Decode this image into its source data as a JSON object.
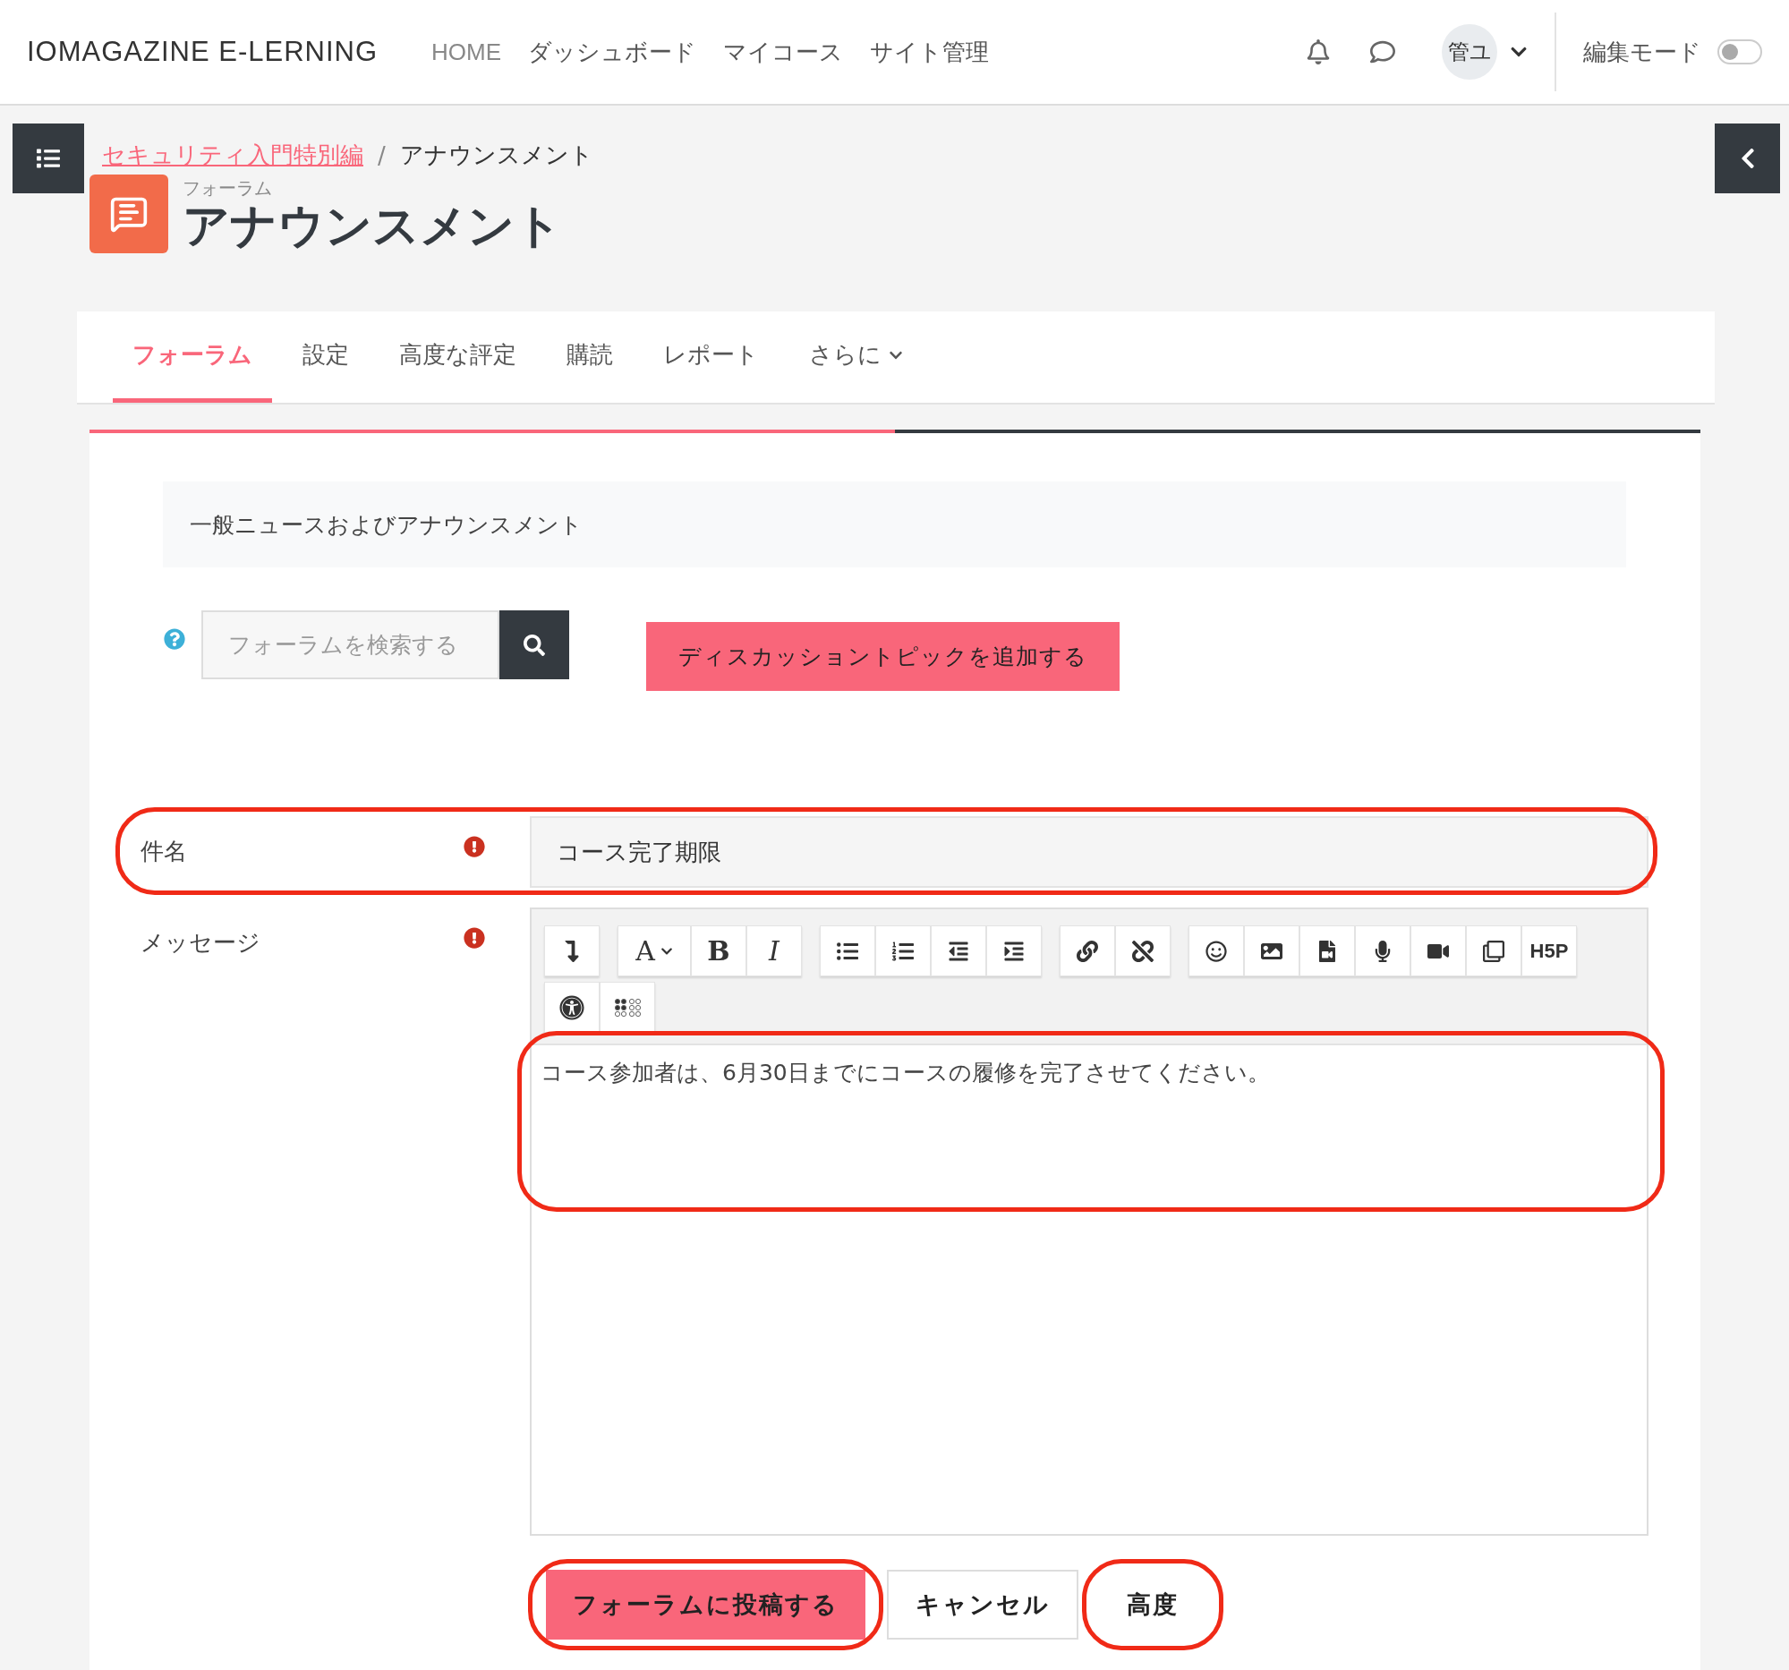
{
  "header": {
    "brand": "IOMAGAZINE E-LERNING",
    "nav": [
      {
        "label": "HOME",
        "kind": "latin"
      },
      {
        "label": "ダッシュボード",
        "kind": "jp"
      },
      {
        "label": "マイコース",
        "kind": "jp"
      },
      {
        "label": "サイト管理",
        "kind": "jp"
      }
    ],
    "user": "管ユ",
    "edit_mode": {
      "label": "編集モード",
      "on": false
    }
  },
  "breadcrumb": [
    {
      "label": "セキュリティ入門特別編",
      "kind": "link"
    },
    {
      "label": "/",
      "kind": "separator"
    },
    {
      "label": "アナウンスメント",
      "kind": "current"
    }
  ],
  "page": {
    "kind_label": "フォーラム",
    "title": "アナウンスメント"
  },
  "tabs": [
    {
      "label": "フォーラム",
      "selected": true,
      "caret": false
    },
    {
      "label": "設定",
      "selected": false,
      "caret": false
    },
    {
      "label": "高度な評定",
      "selected": false,
      "caret": false
    },
    {
      "label": "購読",
      "selected": false,
      "caret": false
    },
    {
      "label": "レポート",
      "selected": false,
      "caret": false
    },
    {
      "label": "さらに",
      "selected": false,
      "caret": true
    }
  ],
  "progress": {
    "level": 0.5
  },
  "description": "一般ニュースおよびアナウンスメント",
  "search": {
    "placeholder": "フォーラムを検索する"
  },
  "add_button": "ディスカッショントピックを追加する",
  "fields": [
    {
      "kind": "input",
      "label": "件名",
      "required": true,
      "value": "コース完了期限",
      "highlighted": true
    },
    {
      "kind": "editor",
      "label": "メッセージ",
      "required": true,
      "value": "コース参加者は、6月30日までにコースの履修を完了させてください。",
      "highlighted": true
    }
  ],
  "toolbar": [
    [
      [
        {
          "kind": "collapse"
        }
      ],
      [
        {
          "kind": "font",
          "label": "A"
        },
        {
          "kind": "bold",
          "label": "B"
        },
        {
          "kind": "italic",
          "label": "I"
        }
      ],
      [
        {
          "kind": "bullets"
        },
        {
          "kind": "numbers"
        },
        {
          "kind": "outdent"
        },
        {
          "kind": "indent"
        }
      ],
      [
        {
          "kind": "link"
        },
        {
          "kind": "unlink"
        }
      ],
      [
        {
          "kind": "emoji"
        },
        {
          "kind": "image"
        },
        {
          "kind": "media"
        },
        {
          "kind": "audio"
        },
        {
          "kind": "video"
        },
        {
          "kind": "files"
        },
        {
          "kind": "h5p",
          "label": "H5P"
        }
      ]
    ],
    [
      [
        {
          "kind": "accessibility"
        },
        {
          "kind": "braille"
        }
      ]
    ]
  ],
  "actions": [
    {
      "label": "フォーラムに投稿する",
      "kind": "primary",
      "highlighted": true
    },
    {
      "label": "キャンセル",
      "kind": "secondary",
      "highlighted": false
    },
    {
      "label": "高度",
      "kind": "plain",
      "highlighted": true
    }
  ]
}
